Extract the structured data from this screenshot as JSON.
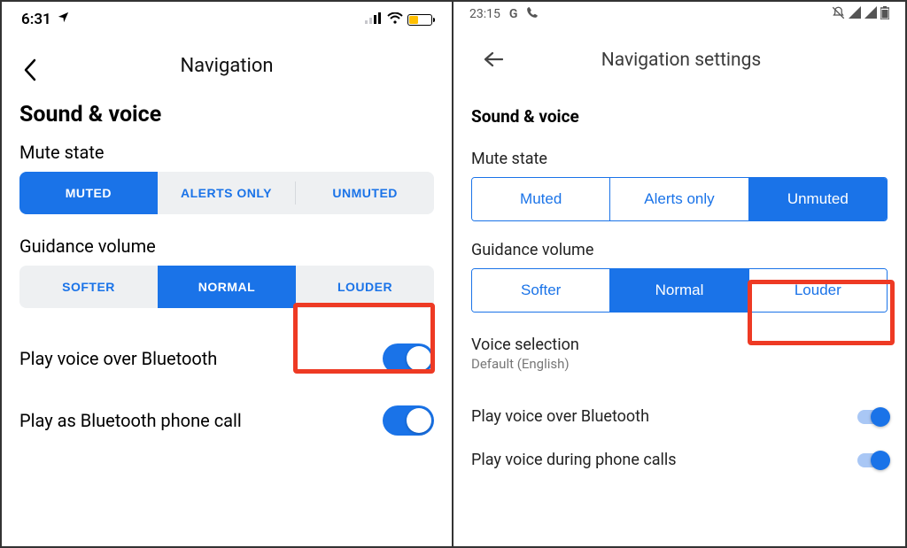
{
  "ios": {
    "status": {
      "time": "6:31"
    },
    "nav_title": "Navigation",
    "section_title": "Sound & voice",
    "mute_label": "Mute state",
    "mute_options": {
      "muted": "MUTED",
      "alerts": "ALERTS ONLY",
      "unmuted": "UNMUTED"
    },
    "guidance_label": "Guidance volume",
    "guidance_options": {
      "softer": "SOFTER",
      "normal": "NORMAL",
      "louder": "LOUDER"
    },
    "row_bluetooth": "Play voice over Bluetooth",
    "row_phonecall": "Play as Bluetooth phone call"
  },
  "android": {
    "status": {
      "time": "23:15"
    },
    "nav_title": "Navigation settings",
    "section_title": "Sound & voice",
    "mute_label": "Mute state",
    "mute_options": {
      "muted": "Muted",
      "alerts": "Alerts only",
      "unmuted": "Unmuted"
    },
    "guidance_label": "Guidance volume",
    "guidance_options": {
      "softer": "Softer",
      "normal": "Normal",
      "louder": "Louder"
    },
    "voice_selection_label": "Voice selection",
    "voice_selection_value": "Default (English)",
    "row_bluetooth": "Play voice over Bluetooth",
    "row_phonecall": "Play voice during phone calls"
  }
}
